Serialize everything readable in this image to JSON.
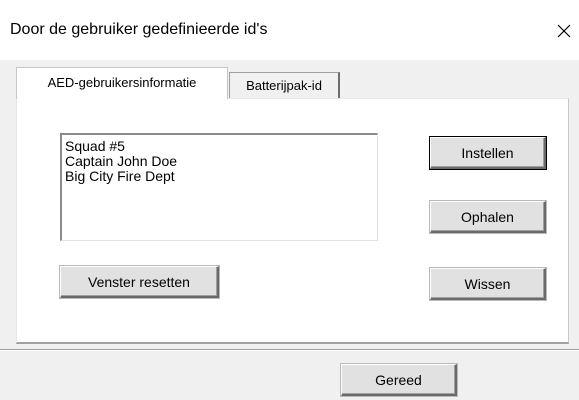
{
  "window": {
    "title": "Door de gebruiker gedefinieerde id's",
    "close_icon": "close-icon"
  },
  "tabs": [
    {
      "label": "AED-gebruikersinformatie",
      "active": true
    },
    {
      "label": "Batterijpak-id",
      "active": false
    }
  ],
  "user_info": {
    "lines": [
      "Squad #5",
      "Captain John Doe",
      "Big City Fire Dept"
    ]
  },
  "buttons": {
    "set": "Instellen",
    "retrieve": "Ophalen",
    "clear": "Wissen",
    "reset_window": "Venster resetten",
    "done": "Gereed"
  },
  "colors": {
    "dialog_bg": "#f0f0f0",
    "panel_bg": "#ffffff",
    "button_face": "#e1e1e1"
  }
}
